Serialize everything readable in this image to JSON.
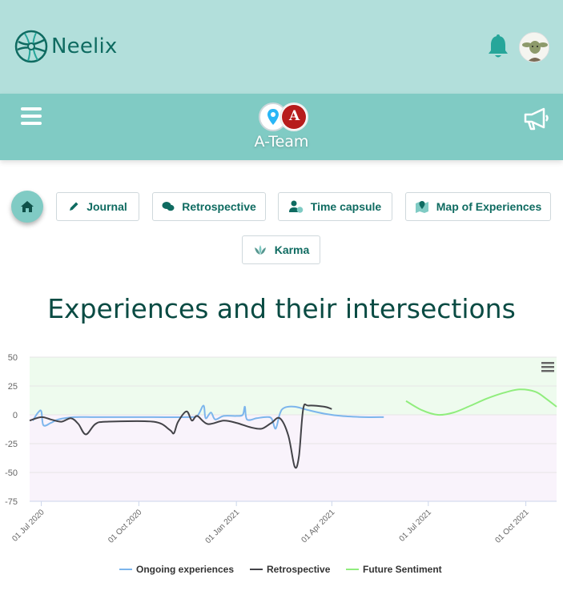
{
  "header": {
    "app_name": "Neelix",
    "logo_icon": "neelix-globe-logo",
    "notifications_icon": "bell-icon",
    "avatar_icon": "user-avatar",
    "accent_color": "#0f6b61"
  },
  "team": {
    "name": "A-Team",
    "menu_icon": "hamburger-icon",
    "announce_icon": "megaphone-icon",
    "badge_letter": "A"
  },
  "nav": {
    "home_icon": "home-icon",
    "buttons": [
      {
        "label": "Journal",
        "icon": "pencil-icon"
      },
      {
        "label": "Retrospective",
        "icon": "chat-bubbles-icon"
      },
      {
        "label": "Time capsule",
        "icon": "user-clock-icon"
      },
      {
        "label": "Map of Experiences",
        "icon": "map-marker-icon"
      },
      {
        "label": "Karma",
        "icon": "lotus-icon"
      }
    ]
  },
  "page_title": "Experiences and their intersections",
  "chart_data": {
    "type": "line",
    "title": "",
    "xlabel": "",
    "ylabel": "",
    "ylim": [
      -75,
      50
    ],
    "yticks": [
      "50",
      "25",
      "0",
      "-25",
      "-50",
      "-75"
    ],
    "xticks": [
      "01 Jul 2020",
      "01 Oct 2020",
      "01 Jan 2021",
      "01 Apr 2021",
      "01 Jul 2021",
      "01 Oct 2021"
    ],
    "xrange": [
      "2020-06-20",
      "2021-10-30"
    ],
    "positive_band_color": "#eefbee",
    "negative_band_color": "#f9f3fb",
    "grid": true,
    "legend_position": "bottom",
    "menu_icon": "chart-menu-icon",
    "series": [
      {
        "name": "Ongoing experiences",
        "color": "#7cb5ec",
        "points": [
          [
            "2020-06-23",
            -5
          ],
          [
            "2020-06-28",
            2
          ],
          [
            "2020-07-01",
            3
          ],
          [
            "2020-07-03",
            -9
          ],
          [
            "2020-07-10",
            -7
          ],
          [
            "2020-07-17",
            -4
          ],
          [
            "2020-08-01",
            -2
          ],
          [
            "2020-08-20",
            -2
          ],
          [
            "2020-09-15",
            -2
          ],
          [
            "2020-10-15",
            -2
          ],
          [
            "2020-11-15",
            -2
          ],
          [
            "2020-11-25",
            -1
          ],
          [
            "2020-12-01",
            8
          ],
          [
            "2020-12-03",
            -3
          ],
          [
            "2020-12-08",
            2
          ],
          [
            "2020-12-12",
            -4
          ],
          [
            "2020-12-20",
            -1
          ],
          [
            "2021-01-01",
            -1
          ],
          [
            "2021-01-07",
            0
          ],
          [
            "2021-01-09",
            7
          ],
          [
            "2021-01-11",
            -4
          ],
          [
            "2021-01-20",
            -3
          ],
          [
            "2021-01-28",
            -2
          ],
          [
            "2021-02-03",
            -3
          ],
          [
            "2021-02-07",
            -12
          ],
          [
            "2021-02-11",
            1
          ],
          [
            "2021-02-15",
            6
          ],
          [
            "2021-02-25",
            7
          ],
          [
            "2021-03-10",
            4
          ],
          [
            "2021-03-25",
            1
          ],
          [
            "2021-04-10",
            -1
          ],
          [
            "2021-05-01",
            -2
          ],
          [
            "2021-05-20",
            -2
          ]
        ]
      },
      {
        "name": "Retrospective",
        "color": "#434348",
        "points": [
          [
            "2020-06-20",
            -5
          ],
          [
            "2020-07-01",
            -2
          ],
          [
            "2020-07-10",
            -4
          ],
          [
            "2020-07-20",
            -6
          ],
          [
            "2020-07-29",
            -3
          ],
          [
            "2020-08-05",
            -8
          ],
          [
            "2020-08-12",
            -17
          ],
          [
            "2020-08-21",
            -8
          ],
          [
            "2020-09-01",
            -6
          ],
          [
            "2020-10-15",
            -6
          ],
          [
            "2020-10-30",
            -13
          ],
          [
            "2020-11-03",
            -16
          ],
          [
            "2020-11-07",
            -6
          ],
          [
            "2020-11-15",
            3
          ],
          [
            "2020-11-20",
            -5
          ],
          [
            "2020-11-25",
            -1
          ],
          [
            "2020-12-05",
            -8
          ],
          [
            "2020-12-20",
            -5
          ],
          [
            "2021-01-01",
            -7
          ],
          [
            "2021-01-15",
            -11
          ],
          [
            "2021-01-25",
            -12
          ],
          [
            "2021-02-03",
            -7
          ],
          [
            "2021-02-11",
            -3
          ],
          [
            "2021-02-19",
            -18
          ],
          [
            "2021-02-25",
            -45
          ],
          [
            "2021-03-01",
            -36
          ],
          [
            "2021-03-05",
            5
          ],
          [
            "2021-03-10",
            8
          ],
          [
            "2021-03-25",
            7
          ],
          [
            "2021-04-01",
            5
          ]
        ]
      },
      {
        "name": "Future Sentiment",
        "color": "#90ed7d",
        "points": [
          [
            "2021-06-10",
            12
          ],
          [
            "2021-06-25",
            4
          ],
          [
            "2021-07-10",
            0
          ],
          [
            "2021-07-25",
            2
          ],
          [
            "2021-08-10",
            8
          ],
          [
            "2021-08-25",
            14
          ],
          [
            "2021-09-10",
            19
          ],
          [
            "2021-09-25",
            22
          ],
          [
            "2021-10-10",
            20
          ],
          [
            "2021-10-20",
            14
          ],
          [
            "2021-10-30",
            7
          ]
        ]
      }
    ]
  }
}
